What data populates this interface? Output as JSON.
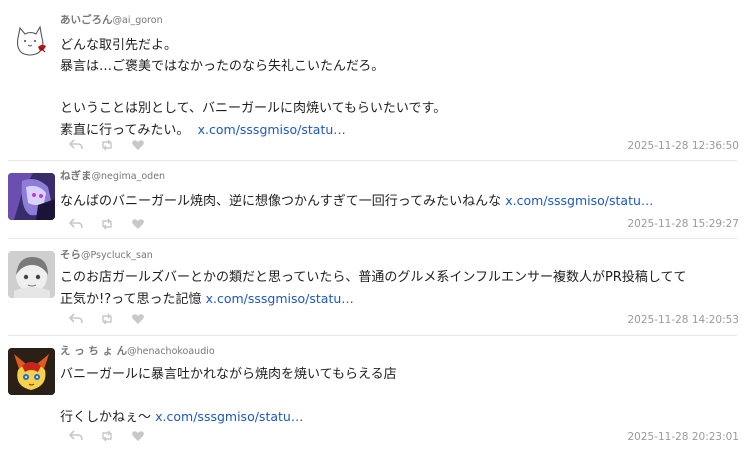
{
  "posts": [
    {
      "display_name": "あいごろん",
      "handle": "@ai_goron",
      "avatar": "cat-sketch-avatar",
      "lines": [
        "どんな取引先だよ。",
        "暴言は…ご褒美ではなかったのなら失礼こいたんだろ。",
        "",
        "ということは別として、バニーガールに肉焼いてもらいたいです。",
        "素直に行ってみたい。"
      ],
      "link": "x.com/sssgmiso/statu…",
      "timestamp": "2025-11-28 12:36:50"
    },
    {
      "display_name": "ねぎま",
      "handle": "@negima_oden",
      "avatar": "purple-character-avatar",
      "lines": [
        "なんばのバニーガール焼肉、逆に想像つかんすぎて一回行ってみたいねんな"
      ],
      "link": "x.com/sssgmiso/statu…",
      "timestamp": "2025-11-28 15:29:27"
    },
    {
      "display_name": "そら",
      "handle": "@Psycluck_san",
      "avatar": "grey-sketch-avatar",
      "lines": [
        "このお店ガールズバーとかの類だと思っていたら、普通のグルメ系インフルエンサー複数人がPR投稿してて",
        "正気か!?って思った記憶"
      ],
      "link": "x.com/sssgmiso/statu…",
      "timestamp": "2025-11-28 14:20:53"
    },
    {
      "display_name": "え っ ち ょ ん",
      "handle": "@henachokoaudio",
      "avatar": "red-creature-avatar",
      "lines": [
        "バニーガールに暴言吐かれながら焼肉を焼いてもらえる店",
        "",
        "行くしかねぇ～"
      ],
      "link": "x.com/sssgmiso/statu…",
      "timestamp": "2025-11-28 20:23:01"
    }
  ],
  "colors": {
    "link": "#1d58c0",
    "muted": "#9a9a9a",
    "icon": "#c8c8c8"
  },
  "icons": [
    "reply-icon",
    "retweet-icon",
    "like-icon"
  ]
}
